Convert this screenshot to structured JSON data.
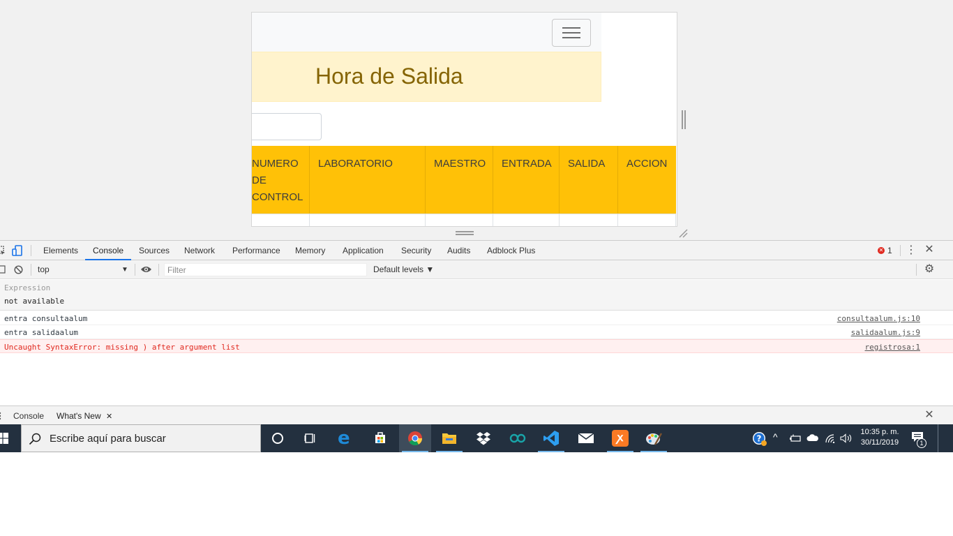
{
  "page": {
    "hamburger_icon": "hamburger-menu-icon",
    "alert_title": "Hora de Salida",
    "table_headers": [
      "NUMERO DE CONTROL",
      "LABORATORIO",
      "MAESTRO",
      "ENTRADA",
      "SALIDA",
      "ACCION"
    ],
    "colors": {
      "alert_bg": "#fff3cd",
      "alert_text": "#856404",
      "table_header_bg": "#ffc107"
    }
  },
  "devtools": {
    "tabs": [
      "Elements",
      "Console",
      "Sources",
      "Network",
      "Performance",
      "Memory",
      "Application",
      "Security",
      "Audits",
      "Adblock Plus"
    ],
    "active_tab": "Console",
    "error_count": "1",
    "toolbar": {
      "context": "top",
      "filter_placeholder": "Filter",
      "levels": "Default levels ▼"
    },
    "expression": {
      "label": "Expression",
      "value": "not available"
    },
    "logs": [
      {
        "message": "entra consultaalum",
        "source": "consultaalum.js:10",
        "level": "log"
      },
      {
        "message": "entra salidaalum",
        "source": "salidaalum.js:9",
        "level": "log"
      },
      {
        "message": "Uncaught SyntaxError: missing ) after argument list",
        "source": "registrosa:1",
        "level": "error"
      }
    ],
    "drawer_tabs": [
      "Console",
      "What's New"
    ],
    "active_drawer_tab": "What's New"
  },
  "taskbar": {
    "search_placeholder": "Escribe aquí para buscar",
    "apps": [
      "cortana-icon",
      "task-view-icon",
      "edge-icon",
      "store-icon",
      "chrome-icon",
      "file-explorer-icon",
      "dropbox-icon",
      "arduino-icon",
      "vscode-icon",
      "mail-icon",
      "xampp-icon",
      "paint-icon"
    ],
    "time": "10:35 p. m.",
    "date": "30/11/2019",
    "notifications": "1"
  }
}
